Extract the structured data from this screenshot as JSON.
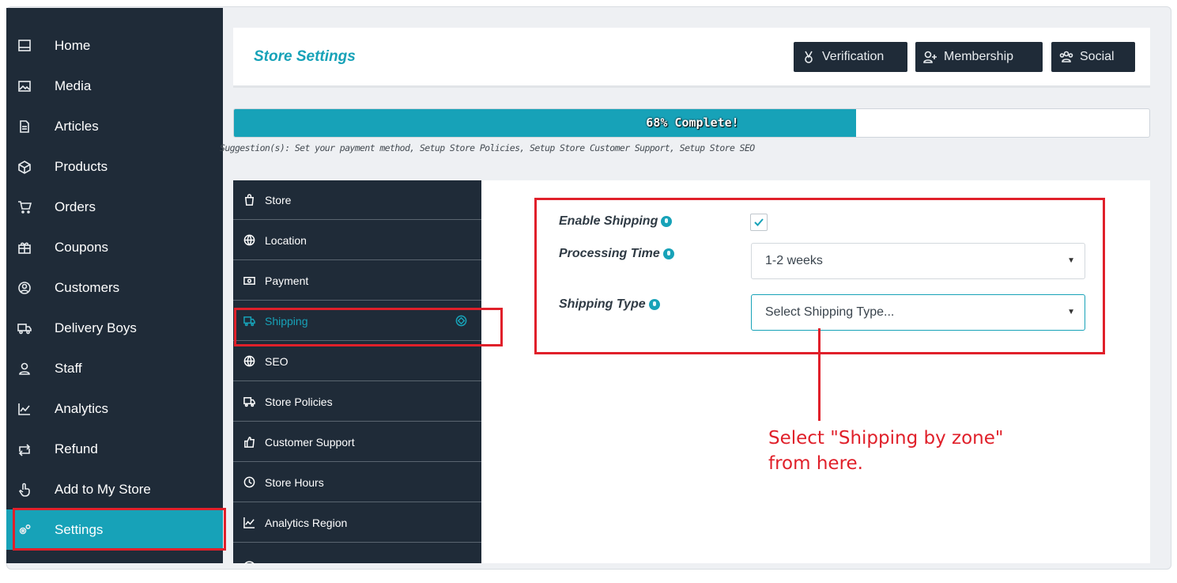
{
  "sidebar": {
    "items": [
      {
        "label": "Home",
        "icon": "home-icon"
      },
      {
        "label": "Media",
        "icon": "image-icon"
      },
      {
        "label": "Articles",
        "icon": "document-icon"
      },
      {
        "label": "Products",
        "icon": "cube-icon"
      },
      {
        "label": "Orders",
        "icon": "cart-icon"
      },
      {
        "label": "Coupons",
        "icon": "gift-icon"
      },
      {
        "label": "Customers",
        "icon": "user-circle-icon"
      },
      {
        "label": "Delivery Boys",
        "icon": "truck-icon"
      },
      {
        "label": "Staff",
        "icon": "user-icon"
      },
      {
        "label": "Analytics",
        "icon": "chart-line-icon"
      },
      {
        "label": "Refund",
        "icon": "exchange-icon"
      },
      {
        "label": "Add to My Store",
        "icon": "hand-pointer-icon"
      },
      {
        "label": "Settings",
        "icon": "cogs-icon",
        "active": true
      }
    ]
  },
  "header": {
    "title": "Store Settings",
    "buttons": [
      {
        "label": "Verification",
        "icon": "medal-icon"
      },
      {
        "label": "Membership",
        "icon": "user-plus-icon"
      },
      {
        "label": "Social",
        "icon": "users-icon"
      }
    ]
  },
  "progress": {
    "percent": 68,
    "label": "68% Complete!",
    "suggestion": "Suggestion(s): Set your payment method, Setup Store Policies, Setup Store Customer Support, Setup Store SEO"
  },
  "settings_tabs": [
    {
      "label": "Store",
      "icon": "bag-icon"
    },
    {
      "label": "Location",
      "icon": "globe-icon"
    },
    {
      "label": "Payment",
      "icon": "money-icon"
    },
    {
      "label": "Shipping",
      "icon": "truck-icon",
      "active": true
    },
    {
      "label": "SEO",
      "icon": "globe-icon"
    },
    {
      "label": "Store Policies",
      "icon": "truck-icon"
    },
    {
      "label": "Customer Support",
      "icon": "thumbs-up-icon"
    },
    {
      "label": "Store Hours",
      "icon": "clock-icon"
    },
    {
      "label": "Analytics Region",
      "icon": "chart-line-icon"
    }
  ],
  "shipping_form": {
    "enable_label": "Enable Shipping",
    "enable_checked": true,
    "processing_label": "Processing Time",
    "processing_value": "1-2 weeks",
    "type_label": "Shipping Type",
    "type_placeholder": "Select Shipping Type..."
  },
  "annotation": {
    "line1": "Select \"Shipping by zone\"",
    "line2": "from here.",
    "color": "#e0202a"
  },
  "colors": {
    "accent": "#17a2b8",
    "dark": "#1f2b38"
  }
}
